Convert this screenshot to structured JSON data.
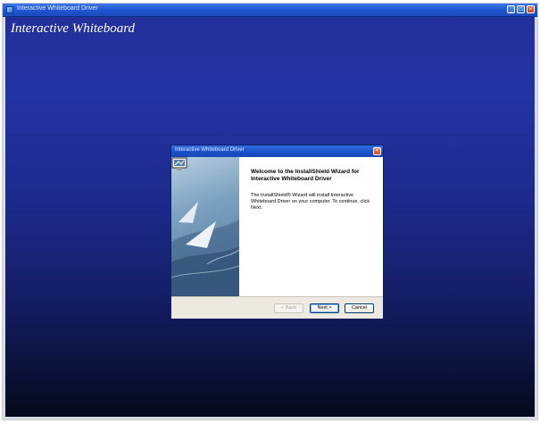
{
  "window": {
    "title": "Interactive Whiteboard Driver",
    "buttons": {
      "minimize": "_",
      "maximize": "□",
      "close": "×"
    }
  },
  "app": {
    "heading": "Interactive Whiteboard"
  },
  "dialog": {
    "title": "Interactive Whiteboard Driver",
    "close_glyph": "×",
    "heading": "Welcome to the InstallShield Wizard for Interactive Whiteboard Driver",
    "description": "The InstallShield® Wizard will install Interactive Whiteboard Driver on your computer.  To continue, click Next.",
    "buttons": {
      "back": "< Back",
      "next": "Next >",
      "cancel": "Cancel"
    }
  },
  "icons": {
    "app": "app-icon",
    "setup": "computer-setup-icon"
  },
  "colors": {
    "titlebar": "#1f55cf",
    "desktop_top": "#2233a4",
    "desktop_bottom": "#060a1c",
    "close_button": "#d44b1f"
  }
}
